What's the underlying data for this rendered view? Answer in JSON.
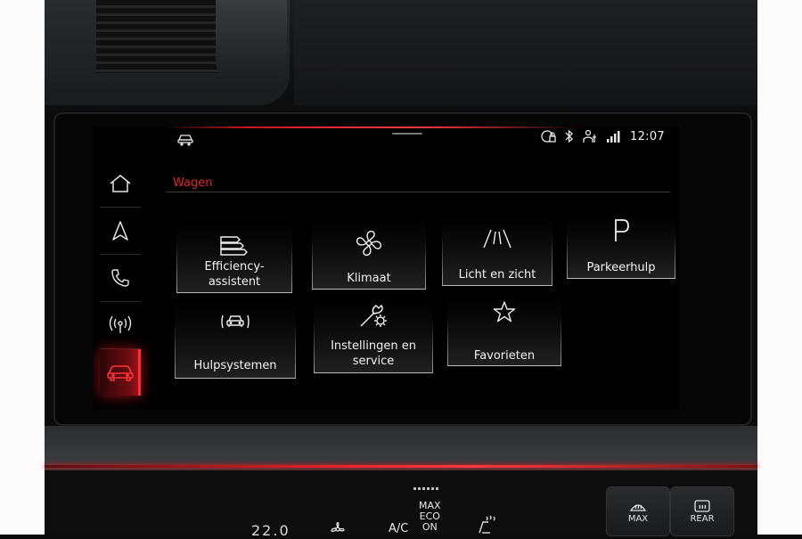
{
  "status": {
    "time": "12:07"
  },
  "nav": {
    "items": [
      {
        "icon": "home-icon"
      },
      {
        "icon": "navigation-arrow-icon"
      },
      {
        "icon": "phone-icon"
      },
      {
        "icon": "radio-media-icon"
      },
      {
        "icon": "car-icon",
        "active": true
      }
    ]
  },
  "page": {
    "title": "Wagen"
  },
  "tiles": [
    {
      "label_line1": "Efficiency-",
      "label_line2": "assistent",
      "icon": "efficiency-bars-icon"
    },
    {
      "label_line1": "Klimaat",
      "label_line2": "",
      "icon": "fan-icon"
    },
    {
      "label_line1": "Licht en zicht",
      "label_line2": "",
      "icon": "light-vision-icon"
    },
    {
      "label_line1": "Parkeerhulp",
      "label_line2": "",
      "icon": "parking-icon"
    },
    {
      "label_line1": "Hulpsystemen",
      "label_line2": "",
      "icon": "assist-systems-icon"
    },
    {
      "label_line1": "Instellingen en",
      "label_line2": "service",
      "icon": "settings-wrench-icon"
    },
    {
      "label_line1": "Favorieten",
      "label_line2": "",
      "icon": "star-icon"
    }
  ],
  "climate": {
    "temp": "22.0",
    "ac": "A/C",
    "max_line1": "MAX",
    "max_line2": "ECO",
    "max_line3": "ON",
    "max_button": "MAX",
    "rear_button": "REAR"
  },
  "colors": {
    "accent_red": "#e0262d",
    "text": "#f3f3f3",
    "background": "#000000"
  }
}
